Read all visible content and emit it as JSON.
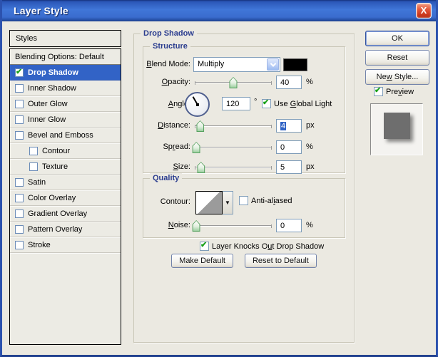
{
  "window": {
    "title": "Layer Style",
    "close": "X"
  },
  "colors": {
    "selection_blue": "#3263C6",
    "titlebar_blue": "#4076D8",
    "close_red": "#CD3A1D",
    "check_green": "#17A017",
    "group_label_navy": "#2B3D8F",
    "blend_swatch": "#000000",
    "preview_square": "#6E6E6E"
  },
  "sidebar": {
    "header": "Styles",
    "items": [
      {
        "label": "Blending Options: Default",
        "checkbox": false,
        "checked": false,
        "selected": false,
        "indent": false
      },
      {
        "label": "Drop Shadow",
        "checkbox": true,
        "checked": true,
        "selected": true,
        "indent": false
      },
      {
        "label": "Inner Shadow",
        "checkbox": true,
        "checked": false,
        "selected": false,
        "indent": false
      },
      {
        "label": "Outer Glow",
        "checkbox": true,
        "checked": false,
        "selected": false,
        "indent": false
      },
      {
        "label": "Inner Glow",
        "checkbox": true,
        "checked": false,
        "selected": false,
        "indent": false
      },
      {
        "label": "Bevel and Emboss",
        "checkbox": true,
        "checked": false,
        "selected": false,
        "indent": false
      },
      {
        "label": "Contour",
        "checkbox": true,
        "checked": false,
        "selected": false,
        "indent": true
      },
      {
        "label": "Texture",
        "checkbox": true,
        "checked": false,
        "selected": false,
        "indent": true
      },
      {
        "label": "Satin",
        "checkbox": true,
        "checked": false,
        "selected": false,
        "indent": false
      },
      {
        "label": "Color Overlay",
        "checkbox": true,
        "checked": false,
        "selected": false,
        "indent": false
      },
      {
        "label": "Gradient Overlay",
        "checkbox": true,
        "checked": false,
        "selected": false,
        "indent": false
      },
      {
        "label": "Pattern Overlay",
        "checkbox": true,
        "checked": false,
        "selected": false,
        "indent": false
      },
      {
        "label": "Stroke",
        "checkbox": true,
        "checked": false,
        "selected": false,
        "indent": false
      }
    ]
  },
  "main": {
    "group_title": "Drop Shadow",
    "structure": {
      "title": "Structure",
      "blend_mode": {
        "label": "*B*lend Mode:",
        "value": "Multiply",
        "swatch_color": "#000000"
      },
      "opacity": {
        "label": "*O*pacity:",
        "value": "40",
        "unit": "%"
      },
      "angle": {
        "label": "*A*ngle:",
        "value": "120",
        "unit": "°",
        "use_global_light": {
          "label": "Use *G*lobal Light",
          "checked": true
        }
      },
      "distance": {
        "label": "*D*istance:",
        "value": "4",
        "unit": "px",
        "value_selected": true
      },
      "spread": {
        "label": "Sp*r*ead:",
        "value": "0",
        "unit": "%"
      },
      "size": {
        "label": "*S*ize:",
        "value": "5",
        "unit": "px"
      }
    },
    "quality": {
      "title": "Quality",
      "contour": {
        "label": "Contour:",
        "dropdown_arrow": "▼",
        "anti_aliased": {
          "label": "Anti-al*i*ased",
          "checked": false
        }
      },
      "noise": {
        "label": "*N*oise:",
        "value": "0",
        "unit": "%"
      }
    },
    "knockout": {
      "label": "Layer Knocks O*u*t Drop Shadow",
      "checked": true
    },
    "buttons": {
      "make_default": "Make Default",
      "reset_to_default": "Reset to Default"
    }
  },
  "actions": {
    "ok": "OK",
    "reset": "Reset",
    "new_style": "Ne*w* Style...",
    "preview": {
      "label": "Pre*v*iew",
      "checked": true
    }
  }
}
